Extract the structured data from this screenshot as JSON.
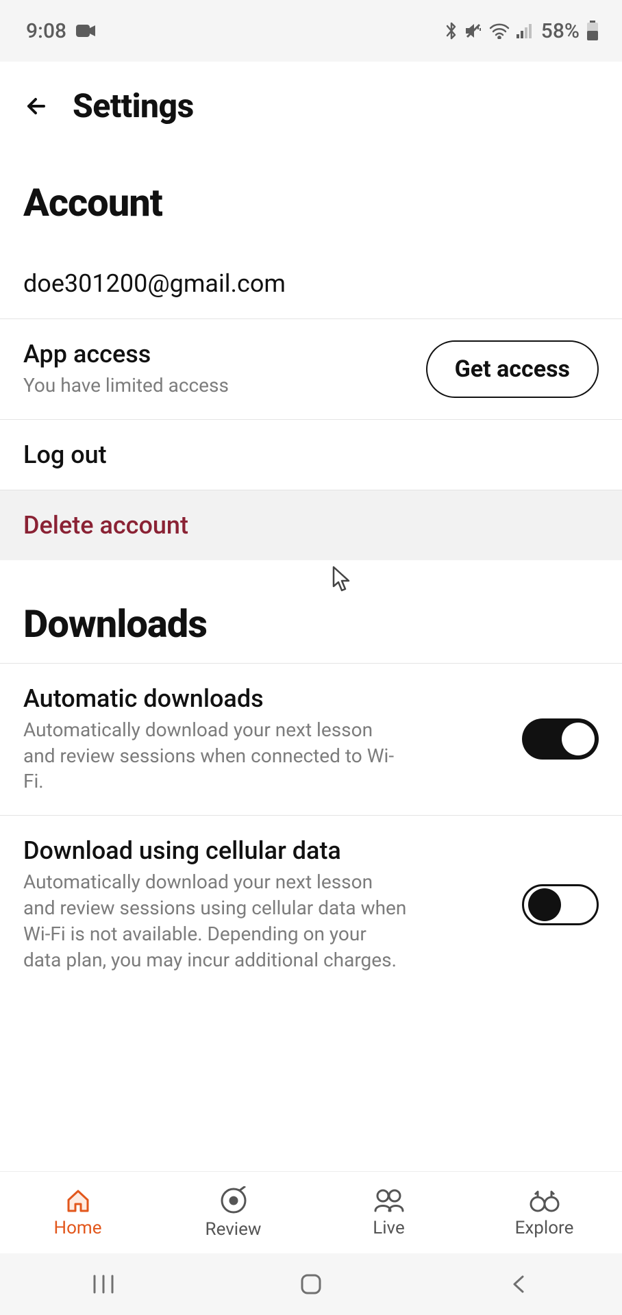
{
  "statusbar": {
    "time": "9:08",
    "battery": "58%"
  },
  "header": {
    "title": "Settings"
  },
  "account": {
    "title": "Account",
    "email": "doe301200@gmail.com",
    "app_access": {
      "label": "App access",
      "sub": "You have limited access",
      "button": "Get access"
    },
    "logout": "Log out",
    "delete": "Delete account"
  },
  "downloads": {
    "title": "Downloads",
    "auto": {
      "label": "Automatic downloads",
      "sub": "Automatically download your next lesson and review sessions when connected to Wi-Fi.",
      "on": true
    },
    "cellular": {
      "label": "Download using cellular data",
      "sub": "Automatically download your next lesson and review sessions using cellular data when Wi-Fi is not available. Depending on your data plan, you may incur additional charges.",
      "on": false
    }
  },
  "nav": {
    "home": "Home",
    "review": "Review",
    "live": "Live",
    "explore": "Explore"
  }
}
